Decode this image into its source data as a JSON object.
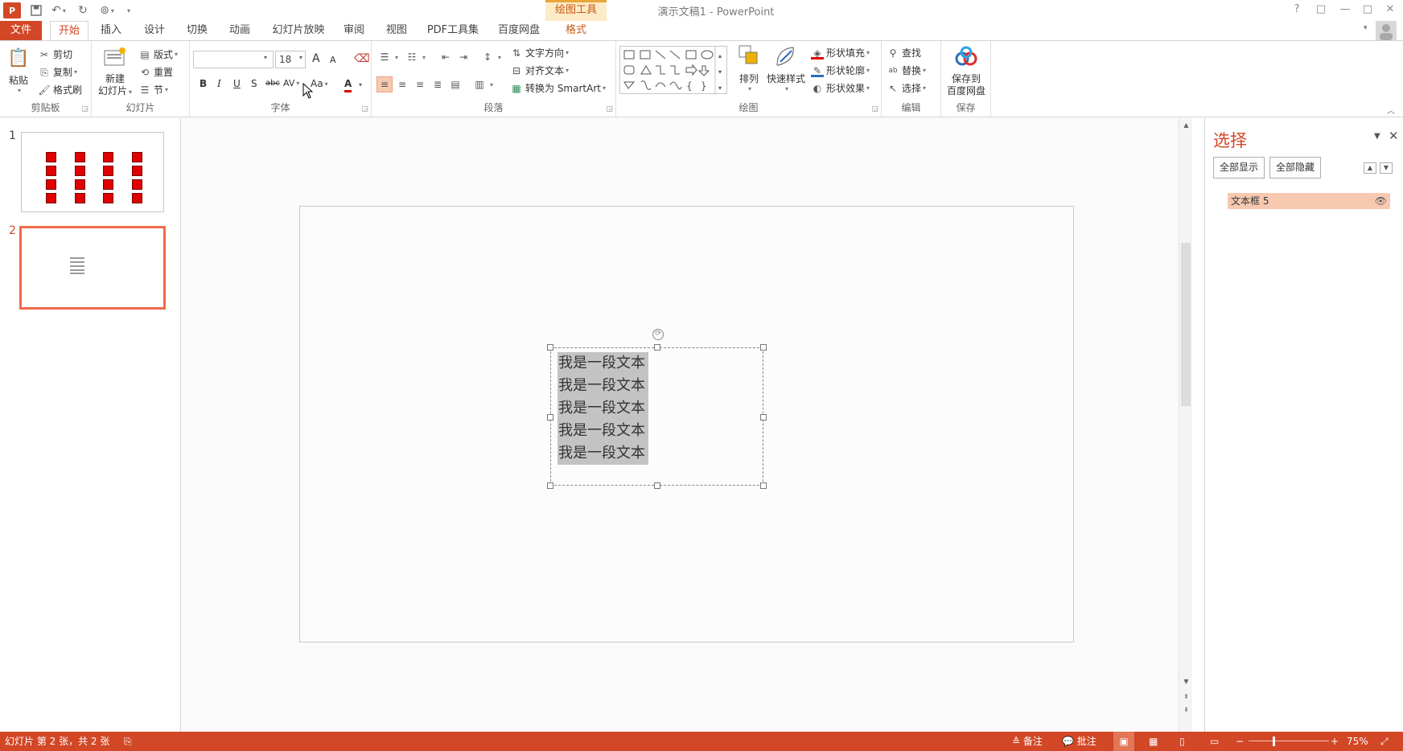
{
  "titlebar": {
    "app_icon": "P",
    "save_icon": "save-icon",
    "undo_icon": "undo-icon",
    "redo_icon": "redo-icon",
    "present_icon": "present-from-start-icon",
    "customize_icon": "customize-qat-icon",
    "drawing_tools": "绘图工具",
    "title": "演示文稿1 - PowerPoint",
    "help": "?",
    "ribbon_options": "□",
    "minimize": "—",
    "maximize": "□",
    "close": "✕"
  },
  "tabs": [
    "文件",
    "开始",
    "插入",
    "设计",
    "切换",
    "动画",
    "幻灯片放映",
    "审阅",
    "视图",
    "PDF工具集",
    "百度网盘",
    "格式"
  ],
  "ribbon": {
    "clipboard": {
      "label": "剪贴板",
      "paste": "粘贴",
      "cut": "剪切",
      "copy": "复制",
      "format_painter": "格式刷"
    },
    "slides": {
      "label": "幻灯片",
      "new_slide_line1": "新建",
      "new_slide_line2": "幻灯片",
      "layout": "版式",
      "reset": "重置",
      "section": "节"
    },
    "font": {
      "label": "字体",
      "font_name": "",
      "font_size": "18",
      "bold": "B",
      "italic": "I",
      "underline": "U",
      "shadow": "S",
      "strike": "abc",
      "spacing": "AV",
      "case": "Aa",
      "color": "A",
      "grow": "A",
      "shrink": "A"
    },
    "paragraph": {
      "label": "段落",
      "text_direction": "文字方向",
      "align_text": "对齐文本",
      "convert_smartart": "转换为 SmartArt"
    },
    "drawing": {
      "label": "绘图",
      "arrange": "排列",
      "quick_styles": "快速样式",
      "shape_fill": "形状填充",
      "shape_outline": "形状轮廓",
      "shape_effects": "形状效果"
    },
    "editing": {
      "label": "编辑",
      "find": "查找",
      "replace": "替换",
      "select": "选择"
    },
    "save": {
      "label": "保存",
      "save_to_line1": "保存到",
      "save_to_line2": "百度网盘"
    }
  },
  "thumbs": {
    "num1": "1",
    "num2": "2"
  },
  "slide": {
    "lines": [
      "我是一段文本",
      "我是一段文本",
      "我是一段文本",
      "我是一段文本",
      "我是一段文本"
    ]
  },
  "selection_pane": {
    "title": "选择",
    "show_all": "全部显示",
    "hide_all": "全部隐藏",
    "items": [
      "文本框 5"
    ]
  },
  "statusbar": {
    "slide_info": "幻灯片 第 2 张，共 2 张",
    "notes": "备注",
    "comments": "批注",
    "zoom": "75%"
  },
  "colors": {
    "accent": "#d24726",
    "drawing_tools": "#c55a11",
    "selection": "#f8c9b1"
  }
}
